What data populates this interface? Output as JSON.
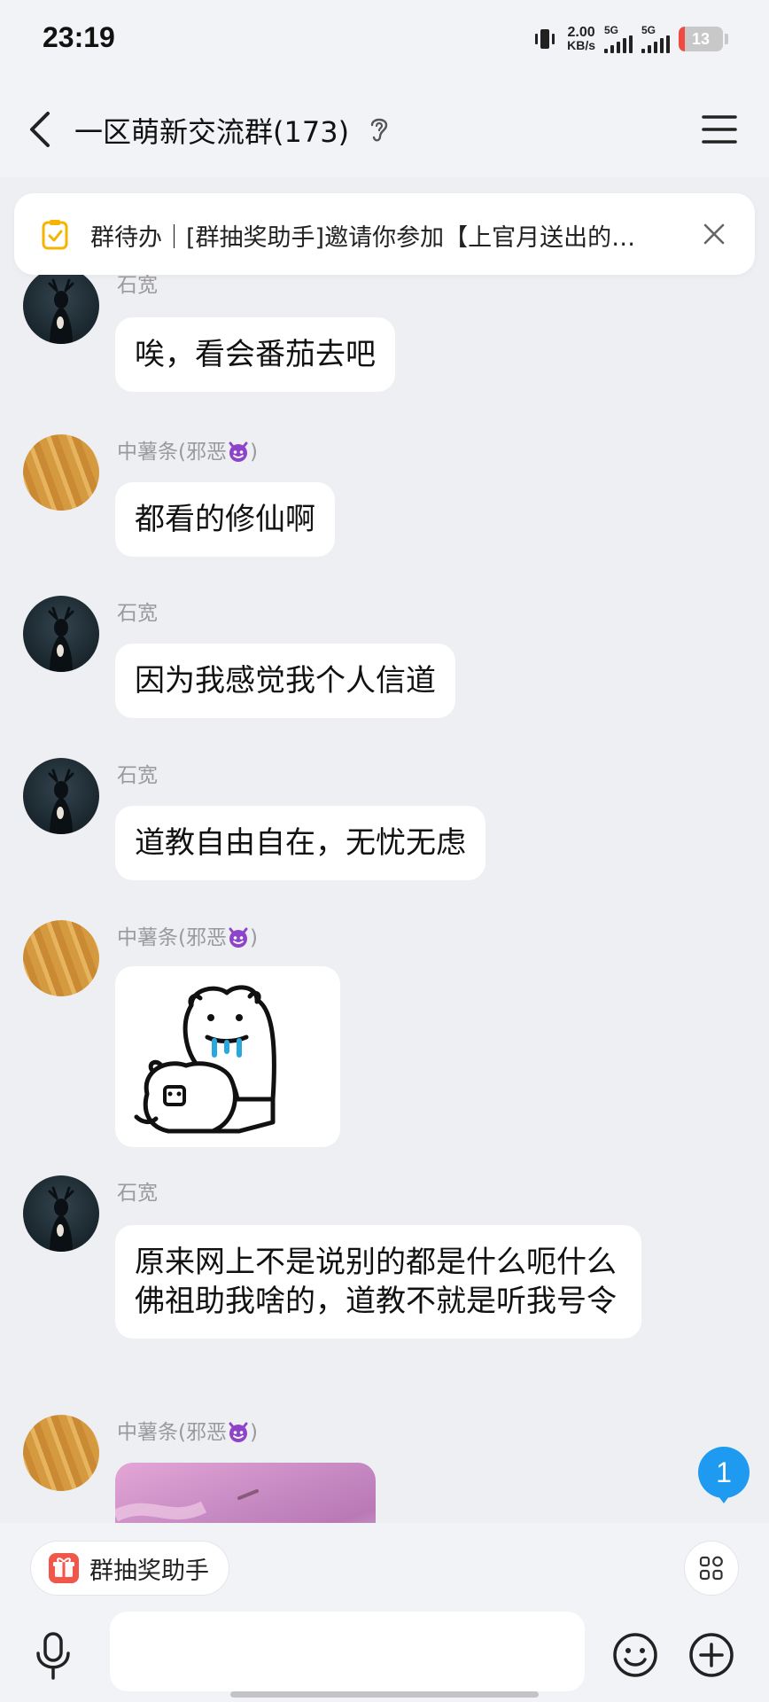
{
  "status_bar": {
    "time": "23:19",
    "net_speed_value": "2.00",
    "net_speed_unit": "KB/s",
    "sim1_label": "5G",
    "sim2_label": "5G",
    "battery_level": "13",
    "battery_color": "#ef4b43"
  },
  "header": {
    "title": "一区萌新交流群(173)",
    "back_icon": "chevron-left-icon",
    "ear_icon": "ear-icon",
    "menu_icon": "hamburger-menu-icon"
  },
  "notice": {
    "text": "群待办｜[群抽奖助手]邀请你参加【上官月送出的…",
    "icon": "todo-clipboard-icon",
    "close_icon": "close-icon",
    "icon_color": "#f4b400"
  },
  "messages": [
    {
      "sender": "石宽",
      "text": "唉，看会番茄去吧",
      "avatar": "deer-avatar"
    },
    {
      "sender": "中薯条(邪恶",
      "text": "都看的修仙啊",
      "avatar": "fries-avatar"
    },
    {
      "sender": "石宽",
      "text": "因为我感觉我个人信道",
      "avatar": "deer-avatar"
    },
    {
      "sender": "石宽",
      "text": "道教自由自在，无忧无虑",
      "avatar": "deer-avatar"
    },
    {
      "sender": "中薯条(邪恶",
      "text": "",
      "avatar": "fries-avatar",
      "image": "bear-sticker"
    },
    {
      "sender": "石宽",
      "text": "原来网上不是说别的都是什么呃什么佛祖助我啥的，道教不就是听我号令",
      "avatar": "deer-avatar"
    },
    {
      "sender": "中薯条(邪恶",
      "text": "",
      "avatar": "fries-avatar",
      "image": "pink-photo"
    }
  ],
  "sender_suffix": ")",
  "unread_count": "1",
  "bottom": {
    "shortcut_label": "群抽奖助手",
    "input_value": "",
    "mic_icon": "microphone-icon",
    "emoji_icon": "emoji-smile-icon",
    "plus_icon": "plus-circle-icon",
    "apps_icon": "apps-grid-icon",
    "gift_icon": "gift-icon"
  },
  "colors": {
    "background": "#eeeff3",
    "bubble": "#ffffff",
    "accent_blue": "#1e9bf0",
    "sender_gray": "#9a9a9e"
  }
}
